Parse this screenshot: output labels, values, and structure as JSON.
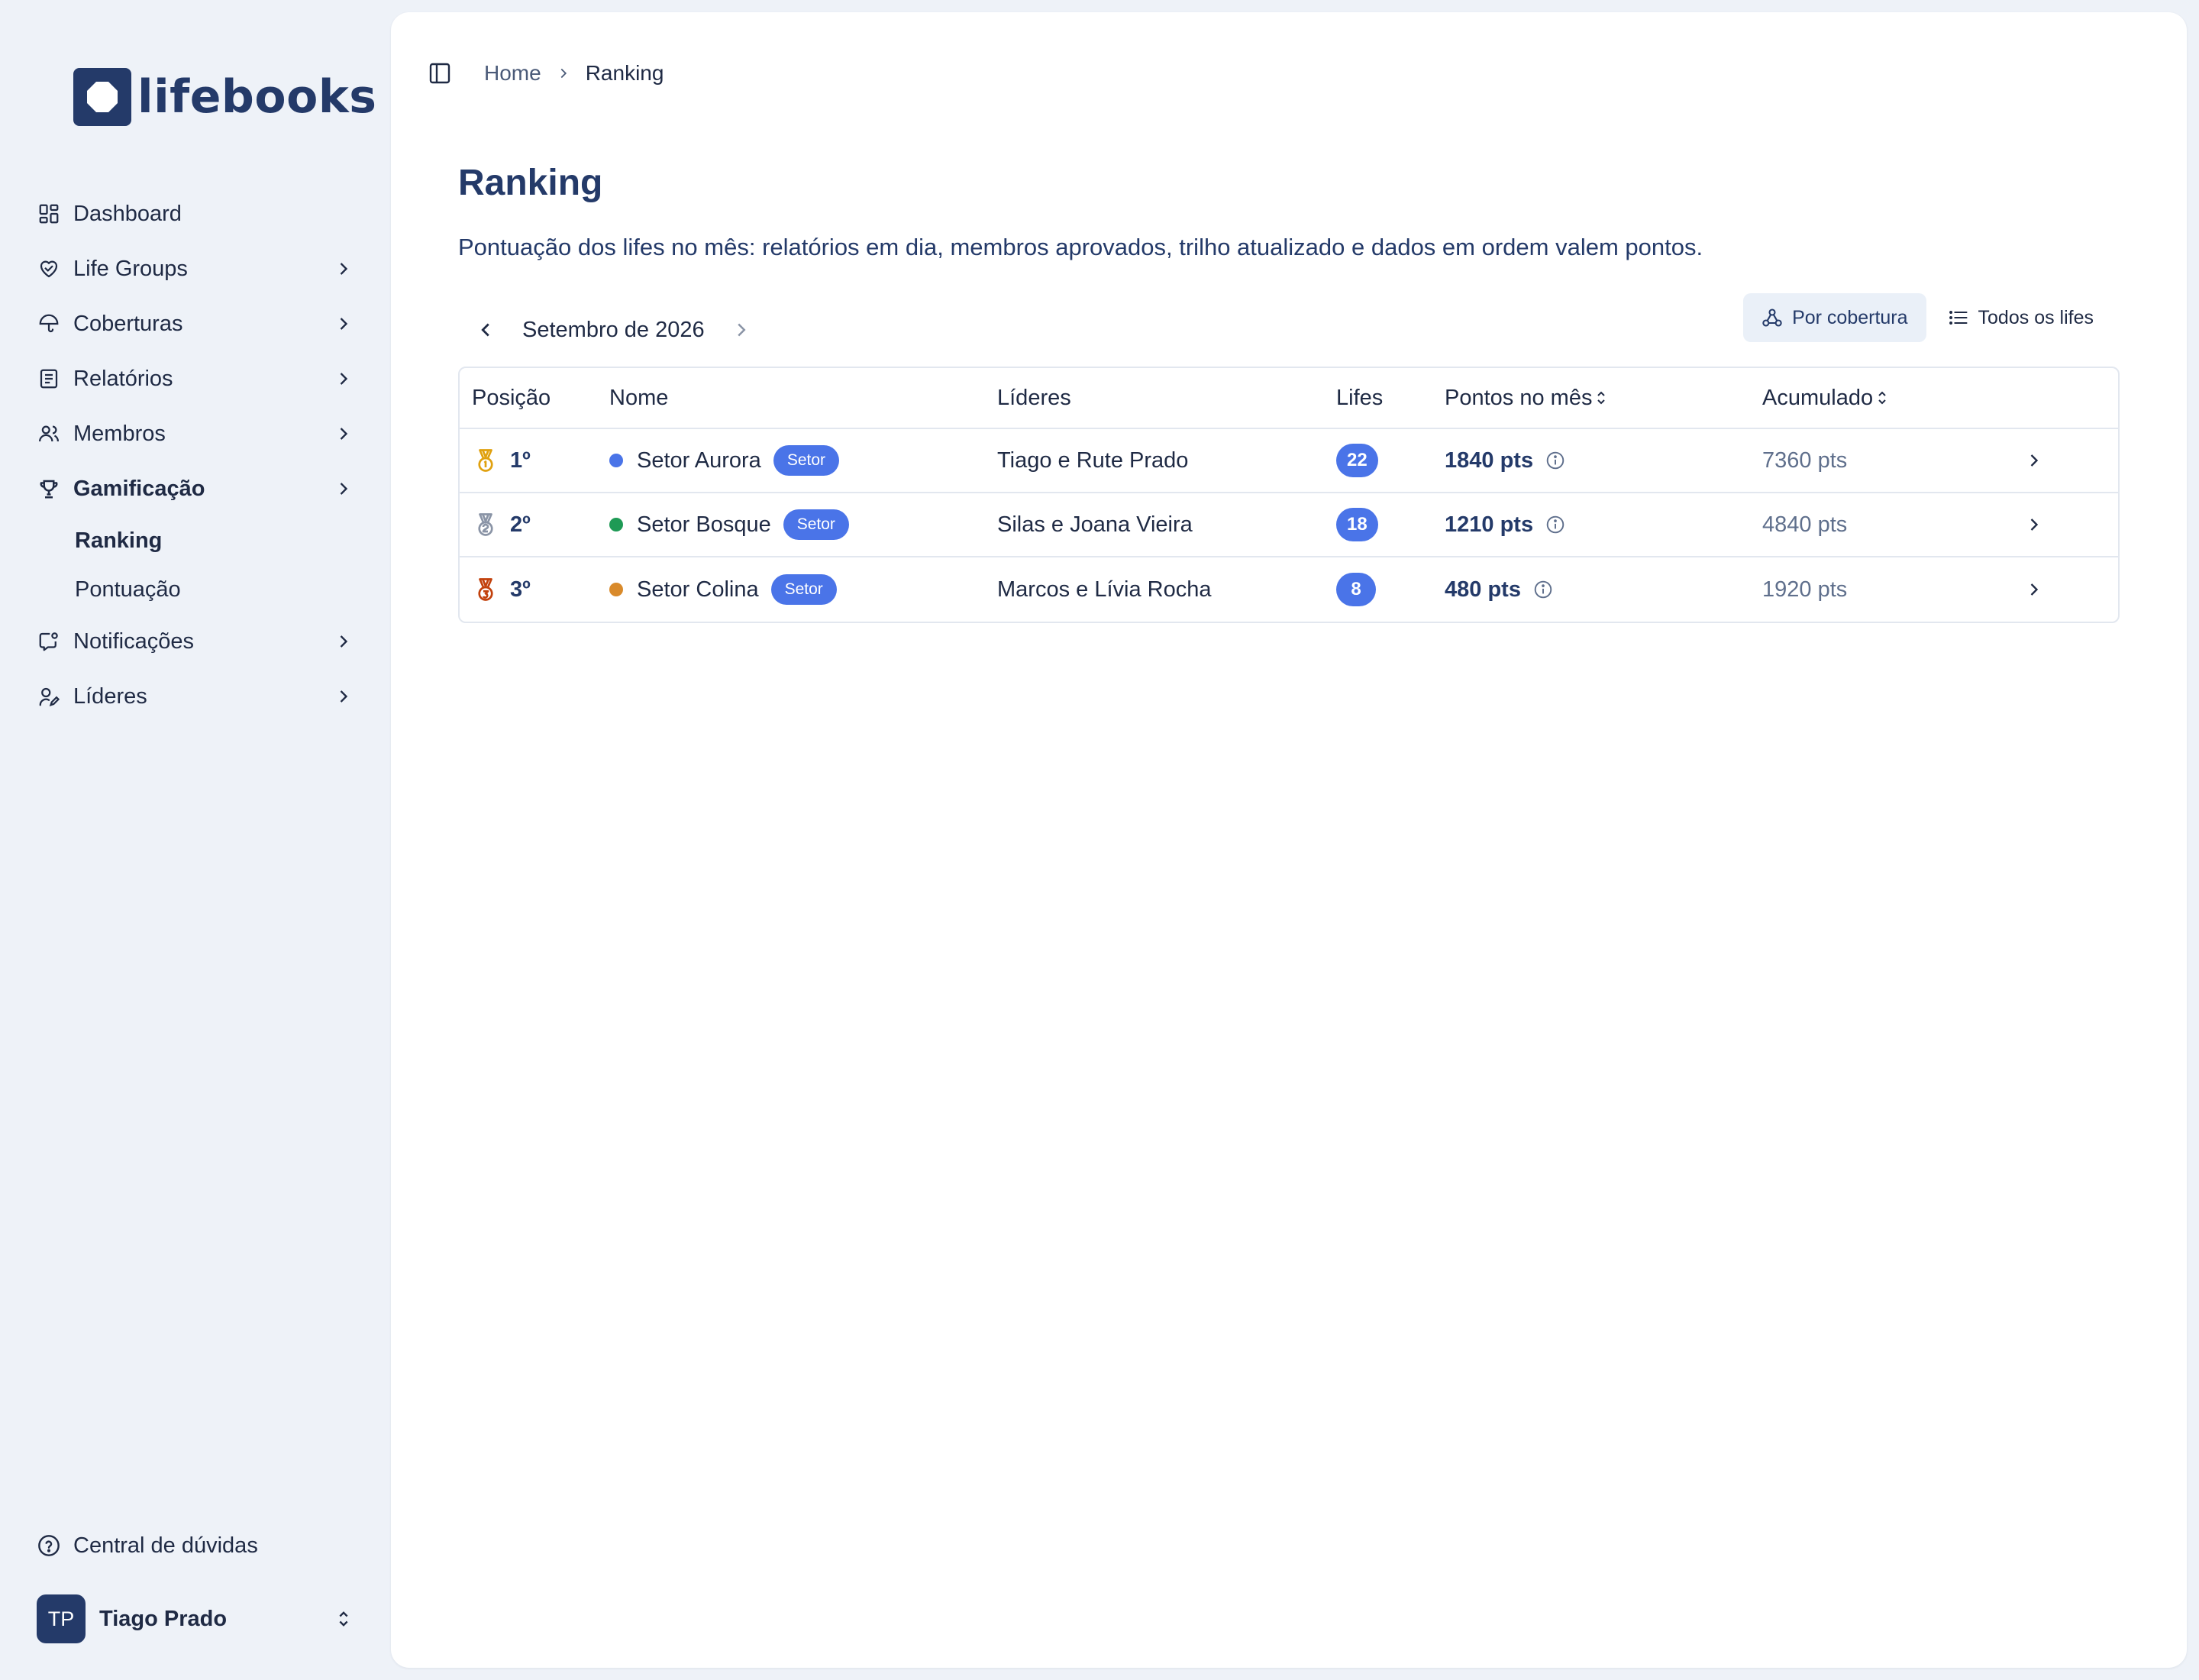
{
  "brand": {
    "name": "lifebooks"
  },
  "sidebar": {
    "items": [
      {
        "label": "Dashboard",
        "icon": "dashboard-icon"
      },
      {
        "label": "Life Groups",
        "icon": "heart-handshake-icon"
      },
      {
        "label": "Coberturas",
        "icon": "umbrella-icon"
      },
      {
        "label": "Relatórios",
        "icon": "report-icon"
      },
      {
        "label": "Membros",
        "icon": "users-icon"
      },
      {
        "label": "Gamificação",
        "icon": "trophy-icon",
        "active": true
      },
      {
        "label": "Notificações",
        "icon": "notification-icon"
      },
      {
        "label": "Líderes",
        "icon": "user-pen-icon"
      }
    ],
    "subitems": [
      {
        "label": "Ranking",
        "active": true
      },
      {
        "label": "Pontuação"
      }
    ],
    "help": "Central de dúvidas",
    "user": {
      "initials": "TP",
      "name": "Tiago Prado"
    }
  },
  "breadcrumb": {
    "home": "Home",
    "current": "Ranking"
  },
  "page": {
    "title": "Ranking",
    "subtitle": "Pontuação dos lifes no mês: relatórios em dia, membros aprovados, trilho atualizado e dados em ordem valem pontos."
  },
  "month": {
    "label": "Setembro de 2026"
  },
  "views": {
    "by_coverage": "Por cobertura",
    "all_lifes": "Todos os lifes"
  },
  "table": {
    "headers": {
      "position": "Posição",
      "name": "Nome",
      "leaders": "Líderes",
      "lifes": "Lifes",
      "points": "Pontos no mês",
      "accumulated": "Acumulado"
    },
    "rows": [
      {
        "position": "1º",
        "medal_color": "#e0a10f",
        "dot_color": "#4a74e8",
        "name": "Setor Aurora",
        "tag": "Setor",
        "leaders": "Tiago e Rute Prado",
        "lifes": "22",
        "points": "1840 pts",
        "accumulated": "7360 pts"
      },
      {
        "position": "2º",
        "medal_color": "#8a94a6",
        "dot_color": "#1e9a55",
        "name": "Setor Bosque",
        "tag": "Setor",
        "leaders": "Silas e Joana Vieira",
        "lifes": "18",
        "points": "1210 pts",
        "accumulated": "4840 pts"
      },
      {
        "position": "3º",
        "medal_color": "#c2410c",
        "dot_color": "#d98a2b",
        "name": "Setor Colina",
        "tag": "Setor",
        "leaders": "Marcos e Lívia Rocha",
        "lifes": "8",
        "points": "480 pts",
        "accumulated": "1920 pts"
      }
    ]
  },
  "colors": {
    "primary": "#243a69",
    "accent": "#4a74e8",
    "background": "#eef2f8"
  }
}
